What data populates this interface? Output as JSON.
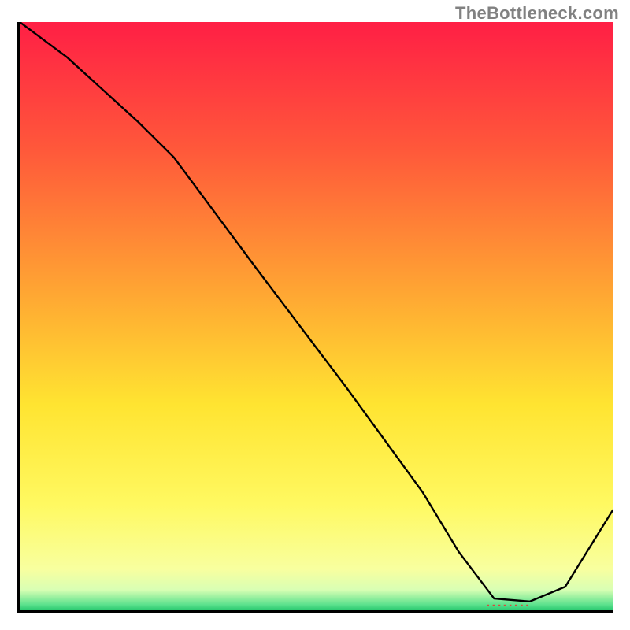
{
  "watermark": "TheBottleneck.com",
  "dash_marker_text": "- - - - - - - -",
  "chart_data": {
    "type": "line",
    "title": "",
    "xlabel": "",
    "ylabel": "",
    "xlim": [
      0,
      100
    ],
    "ylim": [
      0,
      100
    ],
    "grid": false,
    "legend": false,
    "background_gradient": {
      "stops": [
        {
          "offset": 0.0,
          "color": "#ff1f45"
        },
        {
          "offset": 0.22,
          "color": "#ff593a"
        },
        {
          "offset": 0.45,
          "color": "#ffa333"
        },
        {
          "offset": 0.65,
          "color": "#ffe431"
        },
        {
          "offset": 0.82,
          "color": "#fff961"
        },
        {
          "offset": 0.93,
          "color": "#f8ff9f"
        },
        {
          "offset": 0.965,
          "color": "#d9ffb4"
        },
        {
          "offset": 0.99,
          "color": "#5ee28e"
        },
        {
          "offset": 1.0,
          "color": "#28c86f"
        }
      ]
    },
    "series": [
      {
        "name": "bottleneck-curve",
        "color": "#000000",
        "stroke_width": 2.4,
        "x": [
          0,
          8,
          20,
          26,
          40,
          55,
          68,
          74,
          80,
          86,
          92,
          100
        ],
        "values": [
          100,
          94,
          83,
          77,
          58,
          38,
          20,
          10,
          2,
          1.5,
          4,
          17
        ]
      }
    ],
    "marker": {
      "name": "recommended-dash",
      "x": 82,
      "y": 1.2,
      "color": "#d94a3c"
    }
  }
}
